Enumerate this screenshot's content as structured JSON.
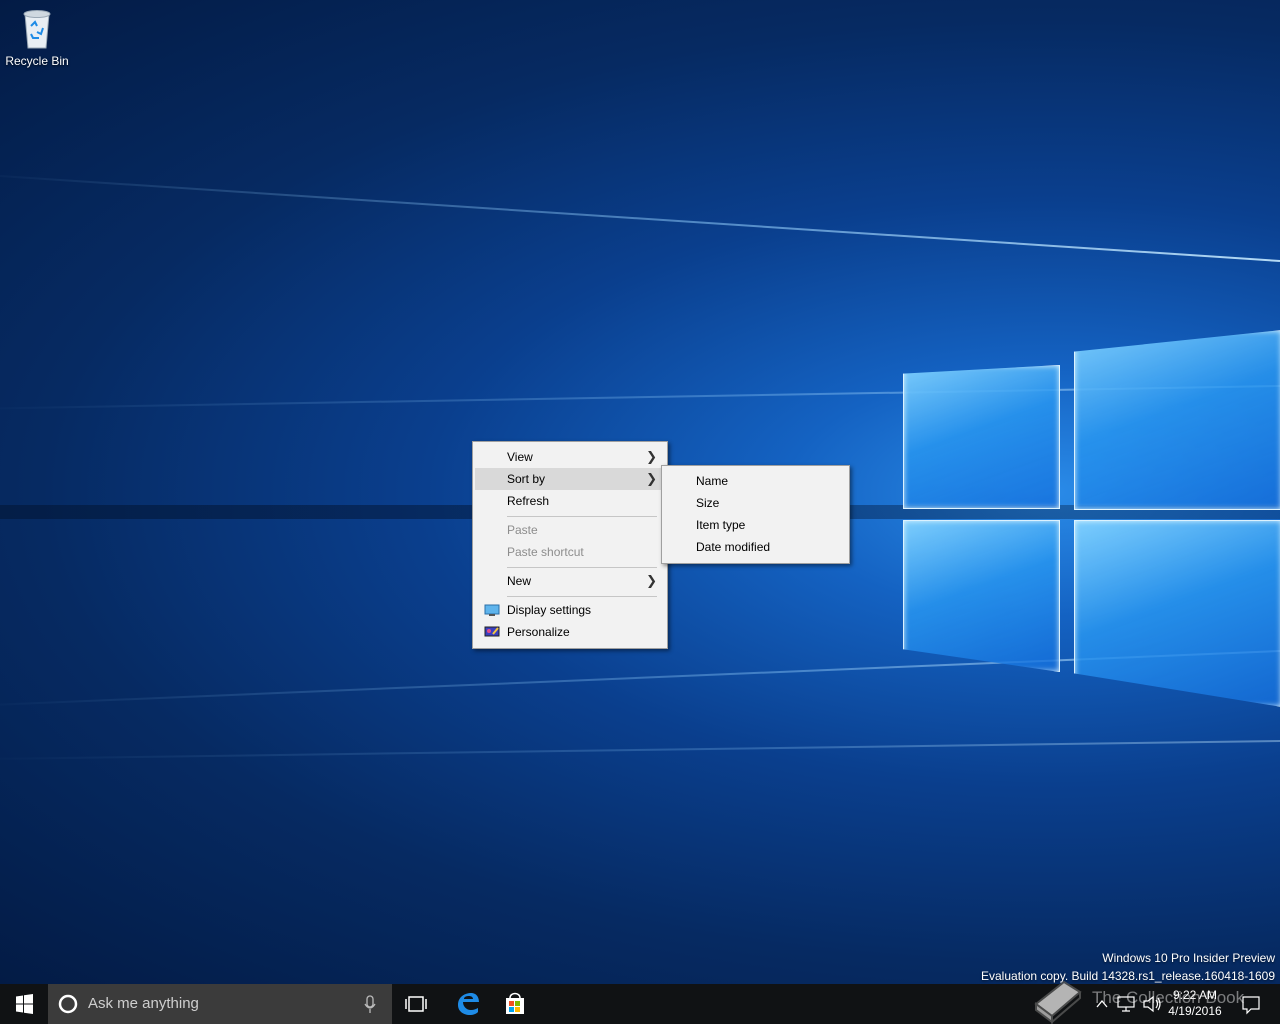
{
  "desktop": {
    "icons": [
      {
        "label": "Recycle Bin"
      }
    ]
  },
  "context_menu": {
    "items": [
      {
        "label": "View",
        "has_submenu": true,
        "disabled": false
      },
      {
        "label": "Sort by",
        "has_submenu": true,
        "disabled": false,
        "highlighted": true
      },
      {
        "label": "Refresh",
        "has_submenu": false,
        "disabled": false
      },
      {
        "label": "Paste",
        "has_submenu": false,
        "disabled": true
      },
      {
        "label": "Paste shortcut",
        "has_submenu": false,
        "disabled": true
      },
      {
        "label": "New",
        "has_submenu": true,
        "disabled": false
      },
      {
        "label": "Display settings",
        "icon": "display-settings-icon",
        "disabled": false
      },
      {
        "label": "Personalize",
        "icon": "personalize-icon",
        "disabled": false
      }
    ]
  },
  "sort_submenu": {
    "items": [
      {
        "label": "Name"
      },
      {
        "label": "Size"
      },
      {
        "label": "Item type"
      },
      {
        "label": "Date modified"
      }
    ]
  },
  "watermark": {
    "line1": "Windows 10 Pro Insider Preview",
    "line2": "Evaluation copy. Build 14328.rs1_release.160418-1609"
  },
  "taskbar": {
    "search_placeholder": "Ask me anything",
    "pinned": [
      "task-view-icon",
      "edge-icon",
      "store-icon"
    ],
    "tray_icons": [
      "chevron-up-icon",
      "network-icon",
      "volume-icon",
      "action-center-icon"
    ],
    "clock_time": "9:22 AM",
    "clock_date": "4/19/2016"
  },
  "overlay": {
    "text": "The Collection Book"
  },
  "colors": {
    "taskbar": "#101214",
    "menu_bg": "#f2f2f2",
    "menu_hover": "#d9d9d9",
    "accent": "#1e8be6"
  }
}
